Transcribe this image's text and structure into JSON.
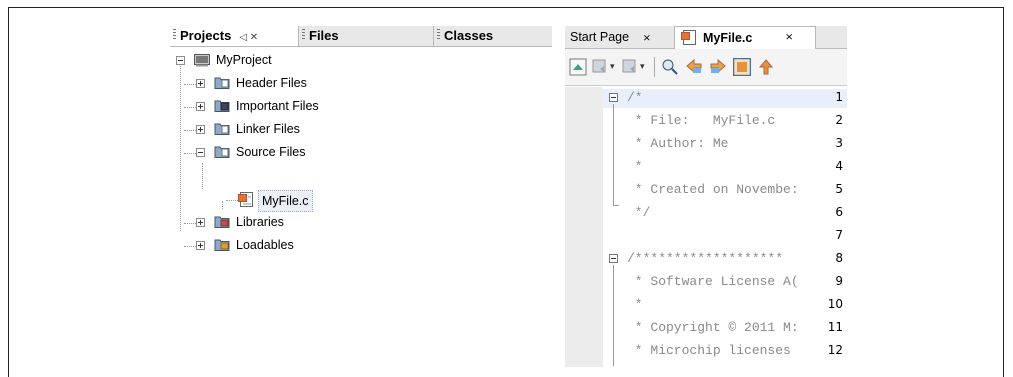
{
  "project_panel": {
    "tabs": [
      {
        "label": "Projects",
        "controls": "◁̲ ⨯"
      },
      {
        "label": "Files"
      },
      {
        "label": "Classes"
      }
    ],
    "tree": {
      "root": "MyProject",
      "items": [
        {
          "label": "Header Files",
          "icon": "folder-header-icon"
        },
        {
          "label": "Important Files",
          "icon": "folder-important-icon"
        },
        {
          "label": "Linker Files",
          "icon": "folder-linker-icon"
        },
        {
          "label": "Source Files",
          "icon": "folder-source-icon",
          "expanded": true,
          "children": [
            "MyFile.c"
          ]
        },
        {
          "label": "Libraries",
          "icon": "folder-libraries-icon"
        },
        {
          "label": "Loadables",
          "icon": "folder-loadables-icon"
        }
      ]
    }
  },
  "editor": {
    "tabs": [
      {
        "label": "Start Page",
        "close": "⨯"
      },
      {
        "label": "MyFile.c",
        "close": "⨯",
        "active": true
      }
    ],
    "lines": [
      {
        "n": "1",
        "text": "/*"
      },
      {
        "n": "2",
        "text": " * File:   MyFile.c"
      },
      {
        "n": "3",
        "text": " * Author: Me"
      },
      {
        "n": "4",
        "text": " *"
      },
      {
        "n": "5",
        "text": " * Created on Novembe:"
      },
      {
        "n": "6",
        "text": " */"
      },
      {
        "n": "7",
        "text": ""
      },
      {
        "n": "8",
        "text": "/*******************"
      },
      {
        "n": "9",
        "text": " * Software License A("
      },
      {
        "n": "10",
        "text": " *"
      },
      {
        "n": "11",
        "text": " * Copyright © 2011 M:"
      },
      {
        "n": "12",
        "text": " * Microchip licenses"
      }
    ]
  }
}
